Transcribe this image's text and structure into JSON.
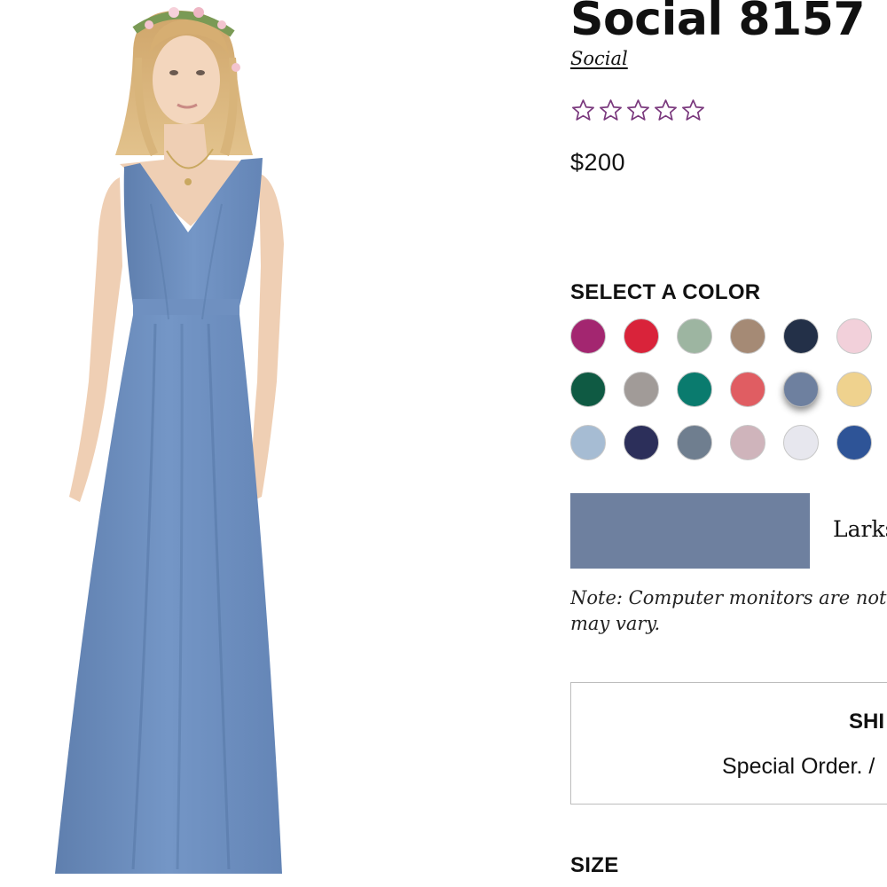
{
  "product": {
    "image_alt": "Model wearing long sleeveless V-neck bridesmaid dress in Larkspur blue",
    "title": "Social 8157",
    "brand": "Social",
    "rating": {
      "value": 0,
      "max": 5,
      "star_color": "#7b3a7e"
    },
    "price": "$200"
  },
  "color_selector": {
    "heading": "SELECT A COLOR",
    "swatches": [
      {
        "color": "#a32670"
      },
      {
        "color": "#d9233a"
      },
      {
        "color": "#9db5a1"
      },
      {
        "color": "#a58a75"
      },
      {
        "color": "#233048"
      },
      {
        "color": "#f2d0da"
      },
      {
        "color": "#0f5a43"
      },
      {
        "color": "#a19b98"
      },
      {
        "color": "#0a7b6e"
      },
      {
        "color": "#e05d62"
      },
      {
        "color": "#6e809f",
        "selected": true
      },
      {
        "color": "#efd28e"
      },
      {
        "color": "#a6bcd3"
      },
      {
        "color": "#2c2f5a"
      },
      {
        "color": "#6f7e8f"
      },
      {
        "color": "#cfb4bb"
      },
      {
        "color": "#e7e7ee"
      },
      {
        "color": "#2e5497"
      }
    ],
    "selected_color_hex": "#6e809f",
    "selected_color_name": "Larks",
    "note": "Note: Computer monitors are not a may vary."
  },
  "shipping": {
    "heading": "SHI",
    "text": "Special Order. /"
  },
  "size": {
    "heading": "SIZE"
  }
}
